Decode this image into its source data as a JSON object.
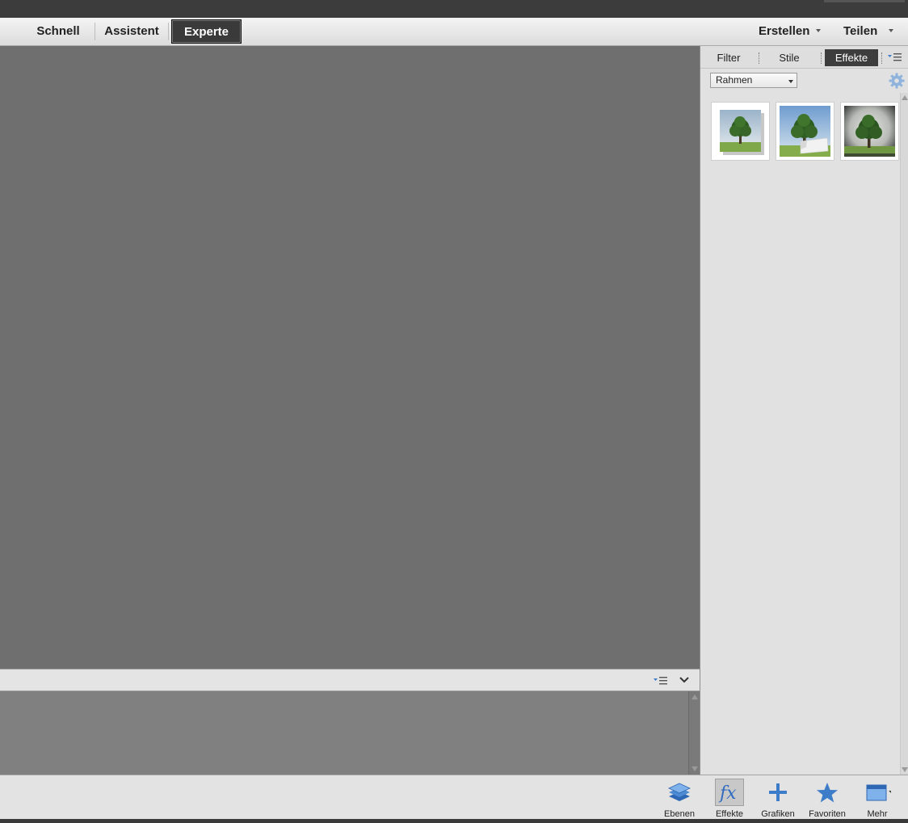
{
  "mode_bar": {
    "tabs": [
      {
        "label": "Schnell"
      },
      {
        "label": "Assistent"
      },
      {
        "label": "Experte",
        "active": true
      }
    ],
    "menus": [
      {
        "label": "Erstellen"
      },
      {
        "label": "Teilen"
      }
    ]
  },
  "panel": {
    "tabs": [
      {
        "label": "Filter"
      },
      {
        "label": "Stile"
      },
      {
        "label": "Effekte",
        "active": true
      }
    ],
    "category_dropdown": {
      "value": "Rahmen"
    },
    "thumbnails": [
      {
        "icon": "tree-drop-shadow-frame-thumbnail"
      },
      {
        "icon": "tree-photo-corner-frame-thumbnail"
      },
      {
        "icon": "tree-vignette-frame-thumbnail"
      }
    ]
  },
  "taskbar": {
    "buttons": [
      {
        "label": "Ebenen",
        "icon": "layers-icon"
      },
      {
        "label": "Effekte",
        "icon": "fx-icon",
        "active": true
      },
      {
        "label": "Grafiken",
        "icon": "plus-icon"
      },
      {
        "label": "Favoriten",
        "icon": "star-icon"
      },
      {
        "label": "Mehr",
        "icon": "window-icon"
      }
    ]
  },
  "colors": {
    "accent_blue": "#3d7cc9",
    "active_tab_bg": "#3a3a3a",
    "canvas_bg": "#6f6f6f"
  }
}
